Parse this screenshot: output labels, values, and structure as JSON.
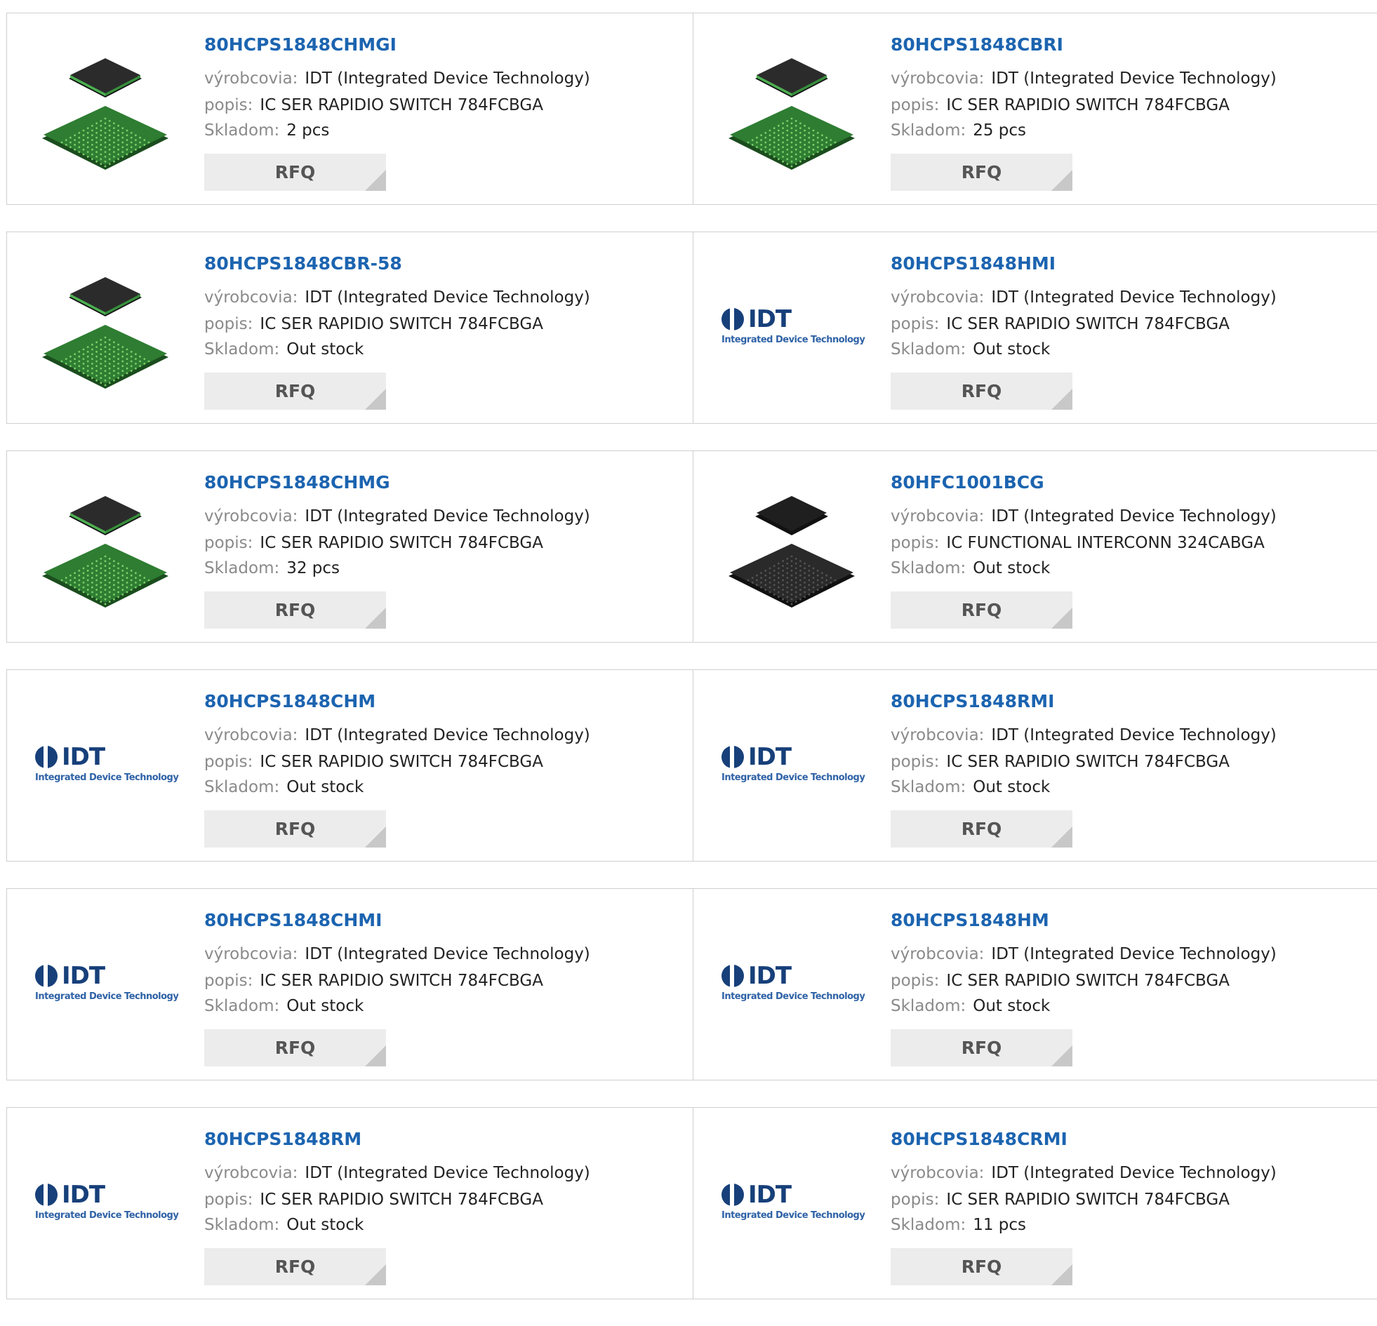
{
  "labels": {
    "manufacturer": "výrobcovia:",
    "description": "popis:",
    "stock": "Skladom:",
    "rfq": "RFQ"
  },
  "logo": {
    "brand": "IDT",
    "tagline": "Integrated Device Technology"
  },
  "products": [
    {
      "part": "80HCPS1848CHMGI",
      "manufacturer": "IDT (Integrated Device Technology)",
      "description": "IC SER RAPIDIO SWITCH 784FCBGA",
      "stock": "2 pcs",
      "image": "bga-chip-green"
    },
    {
      "part": "80HCPS1848CBRI",
      "manufacturer": "IDT (Integrated Device Technology)",
      "description": "IC SER RAPIDIO SWITCH 784FCBGA",
      "stock": "25 pcs",
      "image": "bga-chip-green"
    },
    {
      "part": "80HCPS1848CBR-58",
      "manufacturer": "IDT (Integrated Device Technology)",
      "description": "IC SER RAPIDIO SWITCH 784FCBGA",
      "stock": "Out stock",
      "image": "bga-chip-green"
    },
    {
      "part": "80HCPS1848HMI",
      "manufacturer": "IDT (Integrated Device Technology)",
      "description": "IC SER RAPIDIO SWITCH 784FCBGA",
      "stock": "Out stock",
      "image": "idt-logo"
    },
    {
      "part": "80HCPS1848CHMG",
      "manufacturer": "IDT (Integrated Device Technology)",
      "description": "IC SER RAPIDIO SWITCH 784FCBGA",
      "stock": "32 pcs",
      "image": "bga-chip-green"
    },
    {
      "part": "80HFC1001BCG",
      "manufacturer": "IDT (Integrated Device Technology)",
      "description": "IC FUNCTIONAL INTERCONN 324CABGA",
      "stock": "Out stock",
      "image": "bga-chip-black"
    },
    {
      "part": "80HCPS1848CHM",
      "manufacturer": "IDT (Integrated Device Technology)",
      "description": "IC SER RAPIDIO SWITCH 784FCBGA",
      "stock": "Out stock",
      "image": "idt-logo"
    },
    {
      "part": "80HCPS1848RMI",
      "manufacturer": "IDT (Integrated Device Technology)",
      "description": "IC SER RAPIDIO SWITCH 784FCBGA",
      "stock": "Out stock",
      "image": "idt-logo"
    },
    {
      "part": "80HCPS1848CHMI",
      "manufacturer": "IDT (Integrated Device Technology)",
      "description": "IC SER RAPIDIO SWITCH 784FCBGA",
      "stock": "Out stock",
      "image": "idt-logo"
    },
    {
      "part": "80HCPS1848HM",
      "manufacturer": "IDT (Integrated Device Technology)",
      "description": "IC SER RAPIDIO SWITCH 784FCBGA",
      "stock": "Out stock",
      "image": "idt-logo"
    },
    {
      "part": "80HCPS1848RM",
      "manufacturer": "IDT (Integrated Device Technology)",
      "description": "IC SER RAPIDIO SWITCH 784FCBGA",
      "stock": "Out stock",
      "image": "idt-logo"
    },
    {
      "part": "80HCPS1848CRMI",
      "manufacturer": "IDT (Integrated Device Technology)",
      "description": "IC SER RAPIDIO SWITCH 784FCBGA",
      "stock": "11 pcs",
      "image": "idt-logo"
    }
  ]
}
